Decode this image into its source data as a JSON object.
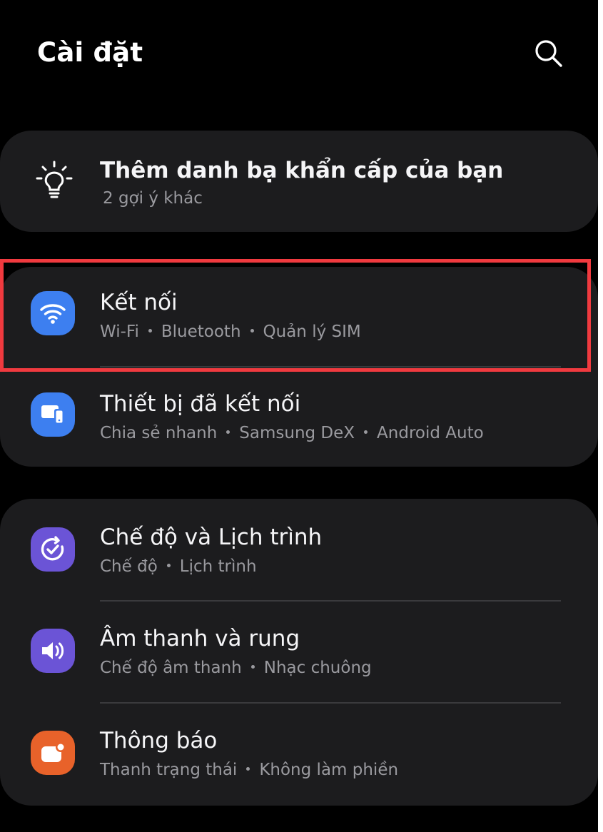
{
  "header": {
    "title": "Cài đặt",
    "search_icon": "search-icon"
  },
  "suggestion": {
    "title": "Thêm danh bạ khẩn cấp của bạn",
    "subtitle": "2 gợi ý khác",
    "icon": "lightbulb-icon"
  },
  "groups": [
    {
      "items": [
        {
          "title": "Kết nối",
          "subtitle": [
            "Wi-Fi",
            "Bluetooth",
            "Quản lý SIM"
          ],
          "icon": "wifi-icon",
          "icon_color": "#3d7ff0",
          "highlighted": true
        },
        {
          "title": "Thiết bị đã kết nối",
          "subtitle": [
            "Chia sẻ nhanh",
            "Samsung DeX",
            "Android Auto"
          ],
          "icon": "connected-devices-icon",
          "icon_color": "#3d7ff0"
        }
      ]
    },
    {
      "items": [
        {
          "title": "Chế độ và Lịch trình",
          "subtitle": [
            "Chế độ",
            "Lịch trình"
          ],
          "icon": "modes-check-icon",
          "icon_color": "#6b54d6"
        },
        {
          "title": "Âm thanh và rung",
          "subtitle": [
            "Chế độ âm thanh",
            "Nhạc chuông"
          ],
          "icon": "speaker-icon",
          "icon_color": "#6b54d6"
        },
        {
          "title": "Thông báo",
          "subtitle": [
            "Thanh trạng thái",
            "Không làm phiền"
          ],
          "icon": "notification-icon",
          "icon_color": "#e8622a"
        }
      ]
    }
  ],
  "colors": {
    "background": "#000000",
    "card": "#1c1c1e",
    "highlight_border": "#f03a3f",
    "subtitle": "#9a9a9f"
  }
}
